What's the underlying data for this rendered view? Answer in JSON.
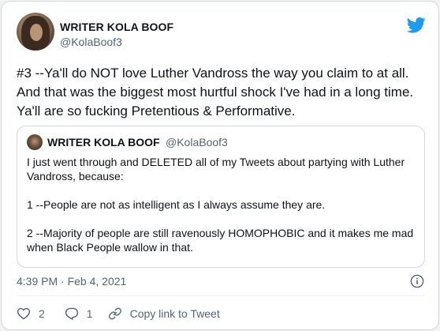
{
  "tweet": {
    "author": {
      "display_name": "WRITER KOLA BOOF",
      "handle": "@KolaBoof3"
    },
    "text": "#3 --Ya'll do NOT love Luther Vandross the way you claim to at all. And that was the biggest most hurtful shock I've had in a long time. Ya'll are so fucking Pretentious & Performative.",
    "timestamp": "4:39 PM · Feb 4, 2021"
  },
  "quoted_tweet": {
    "author": {
      "display_name": "WRITER KOLA BOOF",
      "handle": "@KolaBoof3"
    },
    "paragraphs": [
      "I just went through and DELETED all of my Tweets about partying with Luther Vandross, because:",
      "1 --People are not as intelligent as I always assume they are.",
      "2 --Majority of people are still ravenously HOMOPHOBIC and it makes me mad when Black People wallow in that."
    ]
  },
  "actions": {
    "like_count": "2",
    "reply_count": "1",
    "copy_link_label": "Copy link to Tweet"
  },
  "icons": {
    "brand": "twitter-bird-icon",
    "info": "info-icon",
    "like": "heart-icon",
    "reply": "reply-bubble-icon",
    "link": "link-icon"
  },
  "colors": {
    "twitter_blue": "#1d9bf0",
    "secondary_text": "#536471",
    "border": "#cfd9de"
  }
}
